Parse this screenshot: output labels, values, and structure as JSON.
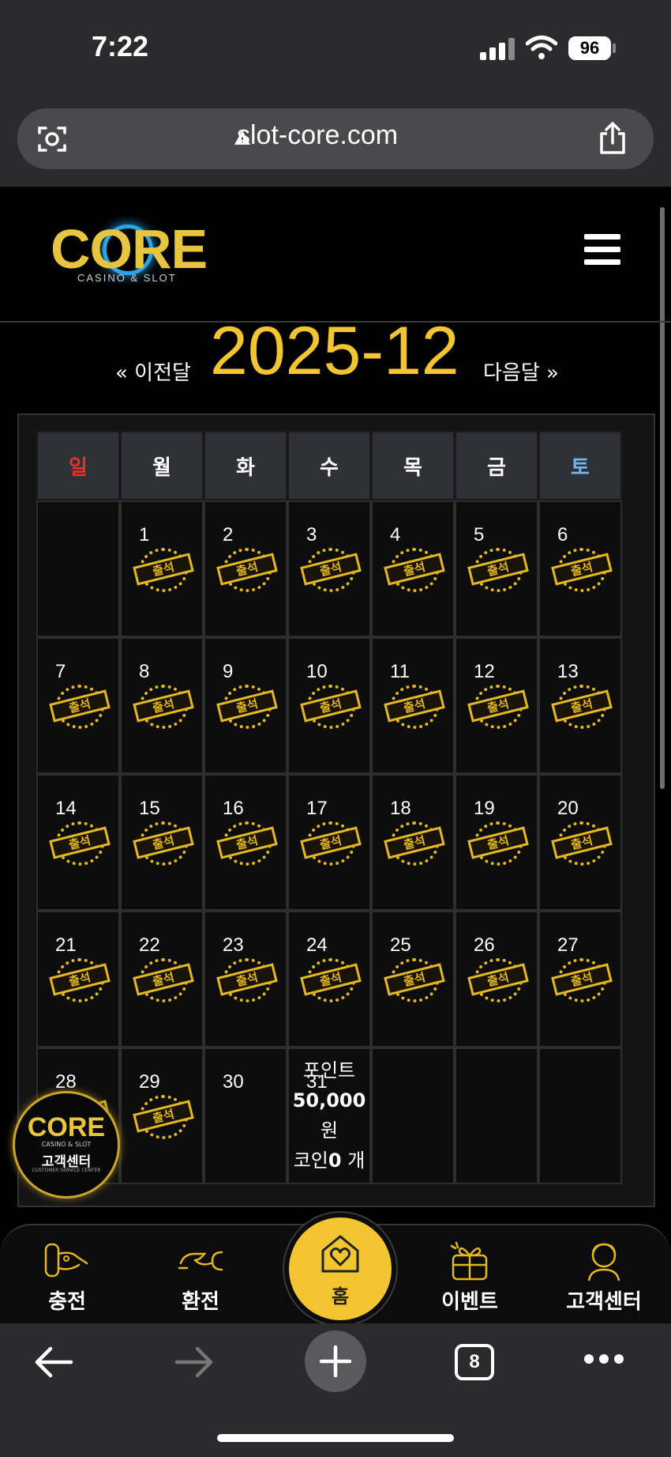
{
  "status_bar": {
    "time": "7:22",
    "battery": "96"
  },
  "browser": {
    "url": "slot-core.com",
    "tab_count": "8"
  },
  "site": {
    "logo_text": "CORE",
    "logo_sub": "CASINO & SLOT",
    "prev_month": "« 이전달",
    "next_month": "다음달 »",
    "month_title": "2025-12"
  },
  "calendar": {
    "weekdays": [
      "일",
      "월",
      "화",
      "수",
      "목",
      "금",
      "토"
    ],
    "weeks": [
      [
        "",
        "1",
        "2",
        "3",
        "4",
        "5",
        "6"
      ],
      [
        "7",
        "8",
        "9",
        "10",
        "11",
        "12",
        "13"
      ],
      [
        "14",
        "15",
        "16",
        "17",
        "18",
        "19",
        "20"
      ],
      [
        "21",
        "22",
        "23",
        "24",
        "25",
        "26",
        "27"
      ],
      [
        "28",
        "29",
        "30",
        "31",
        "",
        "",
        ""
      ]
    ],
    "attended": [
      1,
      2,
      3,
      4,
      5,
      6,
      7,
      8,
      9,
      10,
      11,
      12,
      13,
      14,
      15,
      16,
      17,
      18,
      19,
      20,
      21,
      22,
      23,
      24,
      25,
      26,
      27,
      28,
      29
    ],
    "stamp_text": "출석",
    "points_label": "포인트",
    "points_value": "50,000",
    "points_unit": "원",
    "coin_label": "코인",
    "coin_value": "0",
    "coin_unit": "개"
  },
  "support_float": {
    "logo": "CORE",
    "sub": "CASINO & SLOT",
    "label": "고객센터",
    "en": "CUSTOMER SERVICE CENTER"
  },
  "bottom_nav": {
    "charge": "충전",
    "exchange": "환전",
    "home": "홈",
    "event": "이벤트",
    "support": "고객센터"
  },
  "colors": {
    "accent": "#f2c531",
    "sunday": "#e5322d",
    "saturday": "#6fb6ee"
  }
}
